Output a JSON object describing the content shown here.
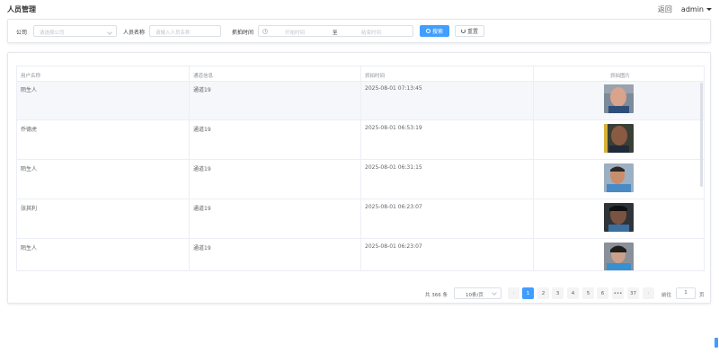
{
  "header": {
    "title": "人员管理",
    "back_label": "返回",
    "user_label": "admin"
  },
  "search": {
    "company_label": "公司",
    "company_placeholder": "请选择公司",
    "name_label": "人员名称",
    "name_placeholder": "请输入人员名称",
    "time_label": "抓拍时间",
    "start_placeholder": "开始时间",
    "range_sep": "至",
    "end_placeholder": "结束时间",
    "search_button": "搜索",
    "reset_button": "重置"
  },
  "table": {
    "columns": [
      "用户名称",
      "通道信息",
      "抓拍时间",
      "抓拍图片"
    ],
    "rows": [
      {
        "name": "陌生人",
        "channel": "通道19",
        "time": "2025-08-01 07:13:45"
      },
      {
        "name": "乔德虎",
        "channel": "通道19",
        "time": "2025-08-01 06:53:19"
      },
      {
        "name": "陌生人",
        "channel": "通道19",
        "time": "2025-08-01 06:31:15"
      },
      {
        "name": "张其利",
        "channel": "通道19",
        "time": "2025-08-01 06:23:07"
      },
      {
        "name": "陌生人",
        "channel": "通道19",
        "time": "2025-08-01 06:23:07"
      }
    ]
  },
  "pagination": {
    "total_text": "共 366 条",
    "page_size": "10条/页",
    "pages": [
      "1",
      "2",
      "3",
      "4",
      "5",
      "6",
      "•••",
      "37"
    ],
    "current": "1",
    "goto_label": "前往",
    "goto_value": "1",
    "goto_suffix": "页"
  },
  "colors": {
    "primary": "#409eff",
    "border": "#ebeef5",
    "text": "#606266"
  }
}
